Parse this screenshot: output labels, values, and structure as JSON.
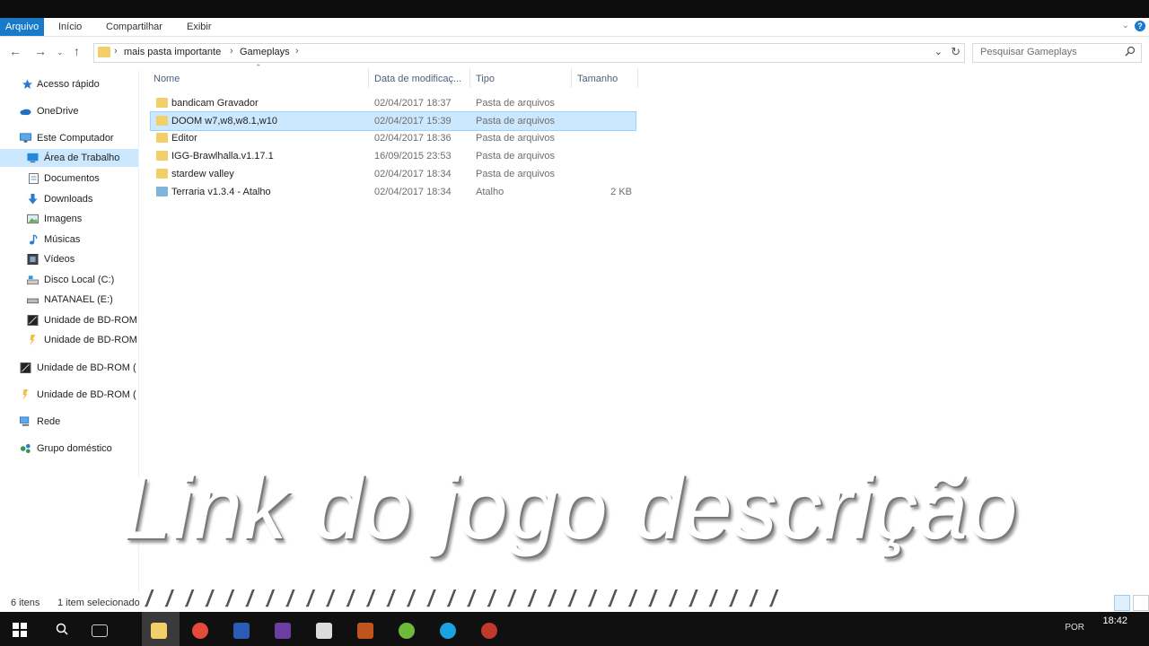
{
  "ribbon": {
    "tabs": [
      {
        "label": "Arquivo",
        "active": true
      },
      {
        "label": "Início"
      },
      {
        "label": "Compartilhar"
      },
      {
        "label": "Exibir"
      }
    ]
  },
  "address": {
    "crumbs": [
      "mais pasta importante",
      "Gameplays"
    ],
    "search_placeholder": "Pesquisar Gameplays"
  },
  "nav": {
    "items": [
      {
        "label": "Acesso rápido",
        "icon": "star-icon"
      },
      {
        "label": "OneDrive",
        "icon": "cloud-icon"
      },
      {
        "label": "Este Computador",
        "icon": "computer-icon"
      },
      {
        "label": "Área de Trabalho",
        "icon": "desktop-icon",
        "selected": true
      },
      {
        "label": "Documentos",
        "icon": "document-icon"
      },
      {
        "label": "Downloads",
        "icon": "download-icon"
      },
      {
        "label": "Imagens",
        "icon": "image-icon"
      },
      {
        "label": "Músicas",
        "icon": "music-icon"
      },
      {
        "label": "Vídeos",
        "icon": "video-icon"
      },
      {
        "label": "Disco Local (C:)",
        "icon": "drive-icon"
      },
      {
        "label": "NATANAEL (E:)",
        "icon": "usb-drive-icon"
      },
      {
        "label": "Unidade de BD-ROM",
        "icon": "bd-rom-icon"
      },
      {
        "label": "Unidade de BD-ROM",
        "icon": "bd-rom-icon"
      },
      {
        "label": "Unidade de BD-ROM (",
        "icon": "bd-rom-icon"
      },
      {
        "label": "Unidade de BD-ROM (",
        "icon": "bd-rom-icon"
      },
      {
        "label": "Rede",
        "icon": "network-icon"
      },
      {
        "label": "Grupo doméstico",
        "icon": "homegroup-icon"
      }
    ]
  },
  "columns": {
    "name": "Nome",
    "date": "Data de modificaç...",
    "type": "Tipo",
    "size": "Tamanho"
  },
  "files": [
    {
      "name": "bandicam Gravador",
      "date": "02/04/2017 18:37",
      "type": "Pasta de arquivos",
      "size": ""
    },
    {
      "name": "DOOM w7,w8,w8.1,w10",
      "date": "02/04/2017 15:39",
      "type": "Pasta de arquivos",
      "size": "",
      "selected": true
    },
    {
      "name": "Editor",
      "date": "02/04/2017 18:36",
      "type": "Pasta de arquivos",
      "size": ""
    },
    {
      "name": "IGG-Brawlhalla.v1.17.1",
      "date": "16/09/2015 23:53",
      "type": "Pasta de arquivos",
      "size": ""
    },
    {
      "name": "stardew valley",
      "date": "02/04/2017 18:34",
      "type": "Pasta de arquivos",
      "size": ""
    },
    {
      "name": "Terraria v1.3.4 - Atalho",
      "date": "02/04/2017 18:34",
      "type": "Atalho",
      "size": "2 KB",
      "shortcut": true
    }
  ],
  "overlay": {
    "text": "Link do jogo descrição",
    "dashes": "/ / / / / / / / / / / / / / / / / / / / / / / / / / / / / / / /"
  },
  "status": {
    "count": "6 itens",
    "selection": "1 item selecionado"
  },
  "taskbar": {
    "time": "18:42",
    "lang": "POR"
  },
  "colors": {
    "accent": "#1979ca",
    "selection": "#cce8ff",
    "folder": "#f3cf6a"
  }
}
